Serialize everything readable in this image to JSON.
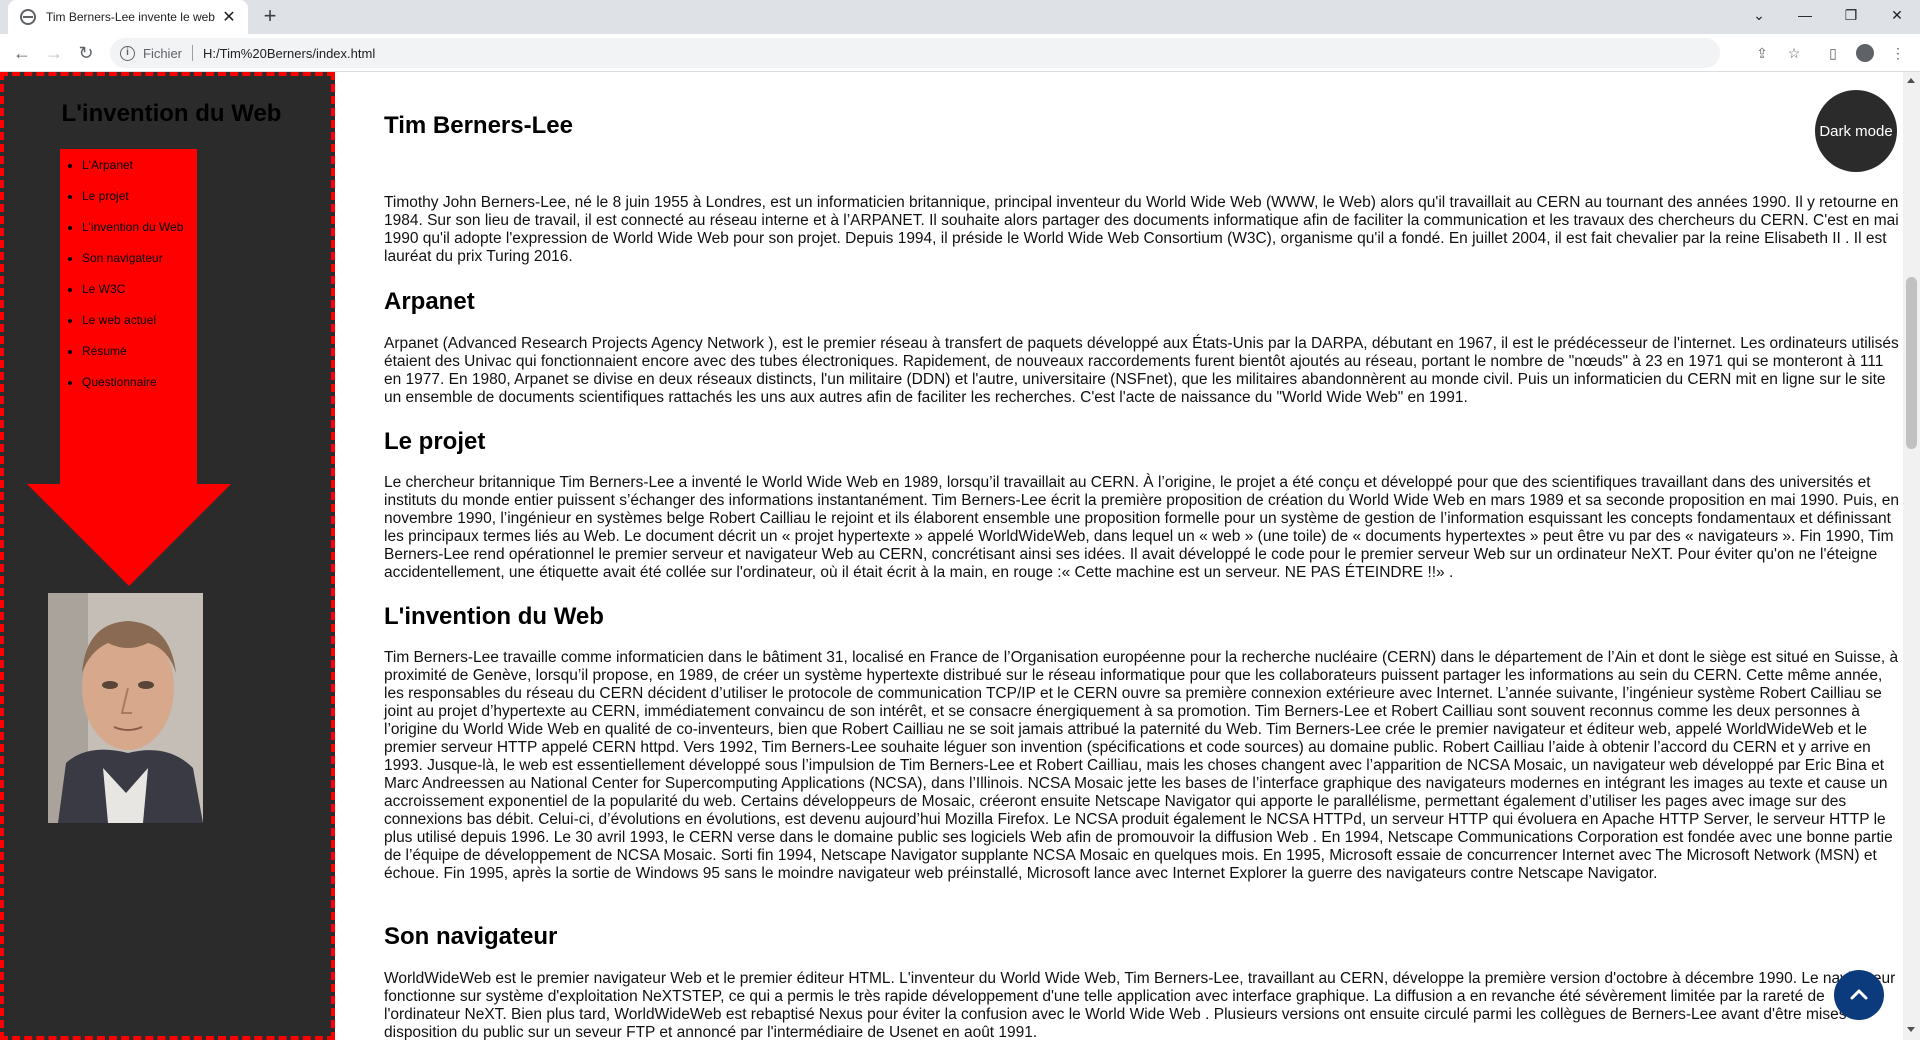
{
  "browser": {
    "tab_title": "Tim Berners-Lee invente le web",
    "security_label": "Fichier",
    "url": "H:/Tim%20Berners/index.html"
  },
  "sidebar": {
    "title": "L'invention du Web",
    "nav_items": [
      "L'Arpanet",
      "Le projet",
      "L'invention du Web",
      "Son navigateur",
      "Le W3C",
      "Le web actuel",
      "Résumé",
      "Questionnaire"
    ]
  },
  "main": {
    "page_title": "Tim Berners-Lee",
    "intro": "Timothy John Berners-Lee, né le 8 juin 1955 à Londres, est un informaticien britannique, principal inventeur du World Wide Web (WWW, le Web) alors qu'il travaillait au CERN au tournant des années 1990. Il y retourne en 1984. Sur son lieu de travail, il est connecté au réseau interne et à l’ARPANET. Il souhaite alors partager des documents informatique afin de faciliter la communication et les travaux des chercheurs du CERN. C'est en mai 1990 qu'il adopte l'expression de World Wide Web pour son projet. Depuis 1994, il préside le World Wide Web Consortium (W3C), organisme qu'il a fondé. En juillet 2004, il est fait chevalier par la reine Elisabeth II . Il est lauréat du prix Turing 2016.",
    "sections": [
      {
        "heading": "Arpanet",
        "text": "Arpanet (Advanced Research Projects Agency Network ), est le premier réseau à transfert de paquets développé aux États-Unis par la DARPA, débutant en 1967, il est le prédécesseur de l'internet. Les ordinateurs utilisés étaient des Univac qui fonctionnaient encore avec des tubes électroniques. Rapidement, de nouveaux raccordements furent bientôt ajoutés au réseau, portant le nombre de \"nœuds\" à 23 en 1971 qui se monteront à 111 en 1977. En 1980, Arpanet se divise en deux réseaux distincts, l'un militaire (DDN) et l'autre, universitaire (NSFnet), que les militaires abandonnèrent au monde civil. Puis un informaticien du CERN mit en ligne sur le site un ensemble de documents scientifiques rattachés les uns aux autres afin de faciliter les recherches. C'est l'acte de naissance du \"World Wide Web\" en 1991."
      },
      {
        "heading": "Le projet",
        "text": "Le chercheur britannique Tim Berners-Lee a inventé le World Wide Web en 1989, lorsqu’il travaillait au CERN. À l’origine, le projet a été conçu et développé pour que des scientifiques travaillant dans des universités et instituts du monde entier puissent s’échanger des informations instantanément. Tim Berners-Lee écrit la première proposition de création du World Wide Web en mars 1989 et sa seconde proposition en mai 1990. Puis, en novembre 1990, l’ingénieur en systèmes belge Robert Cailliau le rejoint et ils élaborent ensemble une proposition formelle pour un système de gestion de l’information esquissant les concepts fondamentaux et définissant les principaux termes liés au Web. Le document décrit un « projet hypertexte » appelé WorldWideWeb, dans lequel un « web » (une toile) de « documents hypertextes » peut être vu par des « navigateurs ». Fin 1990, Tim Berners-Lee rend opérationnel le premier serveur et navigateur Web au CERN, concrétisant ainsi ses idées. Il avait développé le code pour le premier serveur Web sur un ordinateur NeXT. Pour éviter qu'on ne l'éteigne accidentellement, une étiquette avait été collée sur l'ordinateur, où il était écrit à la main, en rouge :« Cette machine est un serveur. NE PAS ÉTEINDRE !!» ."
      },
      {
        "heading": "L'invention du Web",
        "text": "Tim Berners-Lee travaille comme informaticien dans le bâtiment 31, localisé en France de l’Organisation européenne pour la recherche nucléaire (CERN) dans le département de l’Ain et dont le siège est situé en Suisse, à proximité de Genève, lorsqu’il propose, en 1989, de créer un système hypertexte distribué sur le réseau informatique pour que les collaborateurs puissent partager les informations au sein du CERN. Cette même année, les responsables du réseau du CERN décident d’utiliser le protocole de communication TCP/IP et le CERN ouvre sa première connexion extérieure avec Internet. L’année suivante, l’ingénieur système Robert Cailliau se joint au projet d’hypertexte au CERN, immédiatement convaincu de son intérêt, et se consacre énergiquement à sa promotion. Tim Berners-Lee et Robert Cailliau sont souvent reconnus comme les deux personnes à l’origine du World Wide Web en qualité de co-inventeurs, bien que Robert Cailliau ne se soit jamais attribué la paternité du Web. Tim Berners-Lee crée le premier navigateur et éditeur web, appelé WorldWideWeb et le premier serveur HTTP appelé CERN httpd. Vers 1992, Tim Berners-Lee souhaite léguer son invention (spécifications et code sources) au domaine public. Robert Cailliau l’aide à obtenir l’accord du CERN et y arrive en 1993. Jusque-là, le web est essentiellement développé sous l’impulsion de Tim Berners-Lee et Robert Cailliau, mais les choses changent avec l’apparition de NCSA Mosaic, un navigateur web développé par Eric Bina et Marc Andreessen au National Center for Supercomputing Applications (NCSA), dans l’Illinois. NCSA Mosaic jette les bases de l’interface graphique des navigateurs modernes en intégrant les images au texte et cause un accroissement exponentiel de la popularité du web. Certains développeurs de Mosaic, créeront ensuite Netscape Navigator qui apporte le parallélisme, permettant également d’utiliser les pages avec image sur des connexions bas débit. Celui-ci, d’évolutions en évolutions, est devenu aujourd’hui Mozilla Firefox. Le NCSA produit également le NCSA HTTPd, un serveur HTTP qui évoluera en Apache HTTP Server, le serveur HTTP le plus utilisé depuis 1996. Le 30 avril 1993, le CERN verse dans le domaine public ses logiciels Web afin de promouvoir la diffusion Web . En 1994, Netscape Communications Corporation est fondée avec une bonne partie de l’équipe de développement de NCSA Mosaic. Sorti fin 1994, Netscape Navigator supplante NCSA Mosaic en quelques mois. En 1995, Microsoft essaie de concurrencer Internet avec The Microsoft Network (MSN) et échoue. Fin 1995, après la sortie de Windows 95 sans le moindre navigateur web préinstallé, Microsoft lance avec Internet Explorer la guerre des navigateurs contre Netscape Navigator."
      },
      {
        "heading": "Son navigateur",
        "text": "WorldWideWeb est le premier navigateur Web et le premier éditeur HTML. L'inventeur du World Wide Web, Tim Berners-Lee, travaillant au CERN, développe la première version d'octobre à décembre 1990. Le navigateur fonctionne sur système d'exploitation NeXTSTEP, ce qui a permis le très rapide développement d'une telle application avec interface graphique. La diffusion a en revanche été sévèrement limitée par la rareté de l'ordinateur NeXT. Bien plus tard, WorldWideWeb est rebaptisé Nexus pour éviter la confusion avec le World Wide Web . Plusieurs versions ont ensuite circulé parmi les collègues de Berners-Lee avant d'être mises à disposition du public sur un seveur FTP et annoncé par l'intermédiaire de Usenet en août 1991."
      }
    ]
  },
  "dark_mode_label": "Dark mode",
  "icons": {
    "tab_favicon": "globe-icon",
    "info": "info-icon",
    "back_to_top": "chevron-up-icon"
  },
  "colors": {
    "sidebar_bg": "#2b2b2b",
    "accent_red": "#ff0000",
    "back_to_top_bg": "#0b3a7d"
  }
}
